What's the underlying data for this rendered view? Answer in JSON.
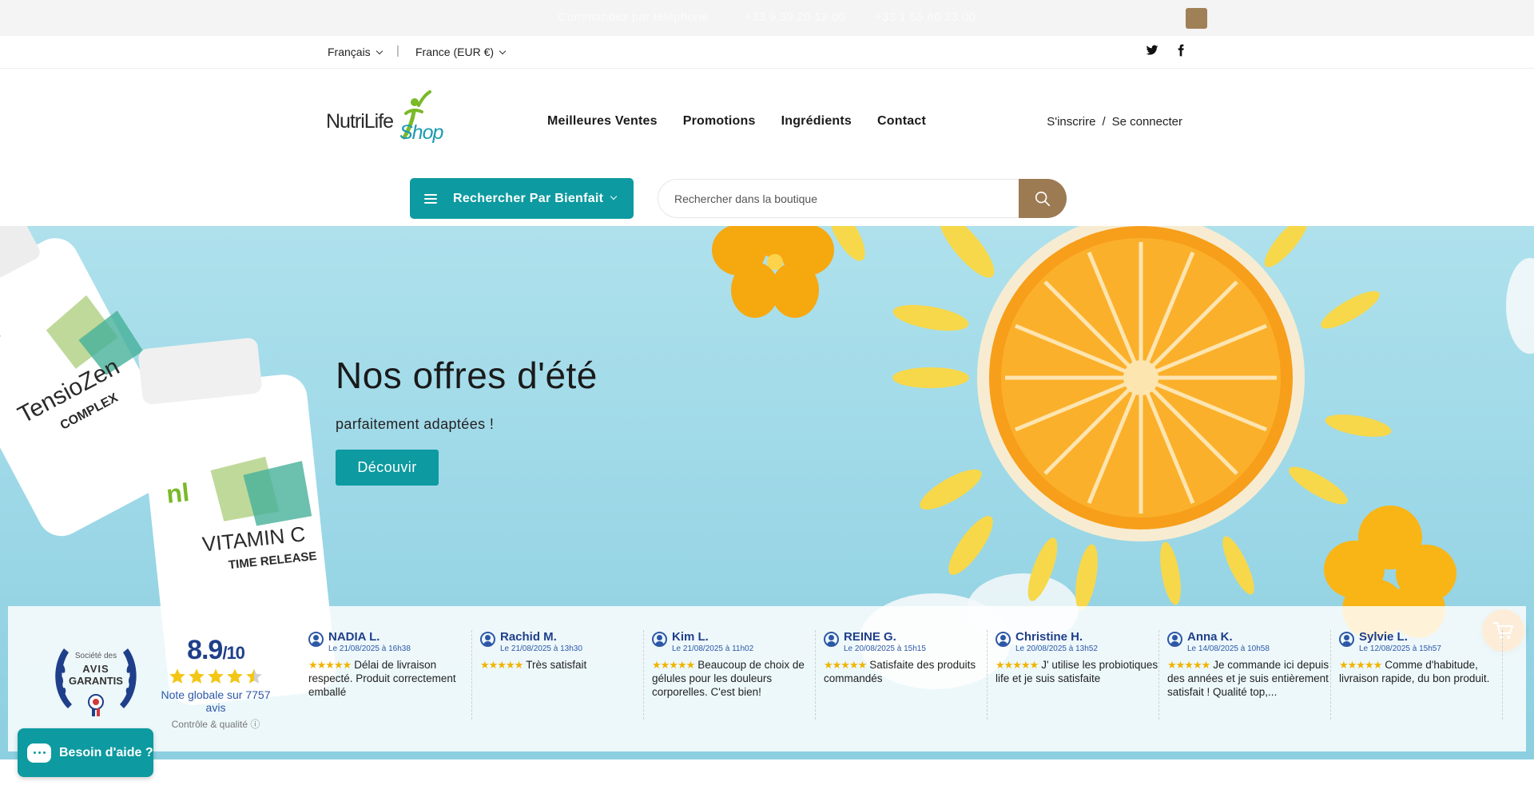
{
  "topbar": {
    "text_1": "Commandez par téléphone :",
    "text_2": "+33 9 39 20 12 00",
    "text_3": "+33 1 55 60 23 00"
  },
  "locale": {
    "language": "Français",
    "country": "France (EUR €)"
  },
  "social": {
    "twitter_icon": "twitter-icon",
    "facebook_icon": "facebook-icon"
  },
  "logo": {
    "text_1": "NutriLife",
    "text_2": "Shop"
  },
  "nav": {
    "items": [
      "Meilleures Ventes",
      "Promotions",
      "Ingrédients",
      "Contact"
    ]
  },
  "account": {
    "register": "S'inscrire",
    "separator": "/",
    "login": "Se connecter"
  },
  "benefit_button": {
    "label": "Rechercher Par Bienfait"
  },
  "search": {
    "placeholder": "Rechercher dans la boutique"
  },
  "hero": {
    "title": "Nos offres d'été",
    "subtitle": "parfaitement adaptées !",
    "cta": "Découvir",
    "bottle_1": {
      "title": "TensioZen",
      "sub": "COMPLEX"
    },
    "bottle_2": {
      "title": "VITAMIN C",
      "sub": "TIME RELEASE"
    }
  },
  "reviews": {
    "badge": {
      "line_1": "Société des",
      "line_2": "AVIS",
      "line_3": "GARANTIS"
    },
    "score": {
      "value": "8.9",
      "scale": "/10",
      "stars": 4.5,
      "note": "Note globale sur 7757 avis",
      "control": "Contrôle & qualité"
    },
    "items": [
      {
        "name": "NADIA L.",
        "date": "Le 21/08/2025 à 16h38",
        "text": "Délai de livraison respecté. Produit correctement emballé"
      },
      {
        "name": "Rachid M.",
        "date": "Le 21/08/2025 à 13h30",
        "text": "Très satisfait"
      },
      {
        "name": "Kim L.",
        "date": "Le 21/08/2025 à 11h02",
        "text": "Beaucoup de choix de gélules pour les douleurs corporelles. C'est bien!"
      },
      {
        "name": "REINE G.",
        "date": "Le 20/08/2025 à 15h15",
        "text": "Satisfaite des produits commandés"
      },
      {
        "name": "Christine H.",
        "date": "Le 20/08/2025 à 13h52",
        "text": "J' utilise les probiotiques life et je suis satisfaite"
      },
      {
        "name": "Anna K.",
        "date": "Le 14/08/2025 à 10h58",
        "text": "Je commande ici depuis des années et je suis entièrement satisfait ! Qualité top,..."
      },
      {
        "name": "Sylvie L.",
        "date": "Le 12/08/2025 à 15h57",
        "text": "Comme d'habitude, livraison rapide, du bon produit."
      }
    ],
    "stars_text": "★★★★★"
  },
  "help": {
    "label": "Besoin d'aide ?"
  },
  "colors": {
    "teal": "#0d9aa0",
    "brown": "#9c7a52",
    "orange": "#f28d0f",
    "navy": "#1f3f8a"
  }
}
